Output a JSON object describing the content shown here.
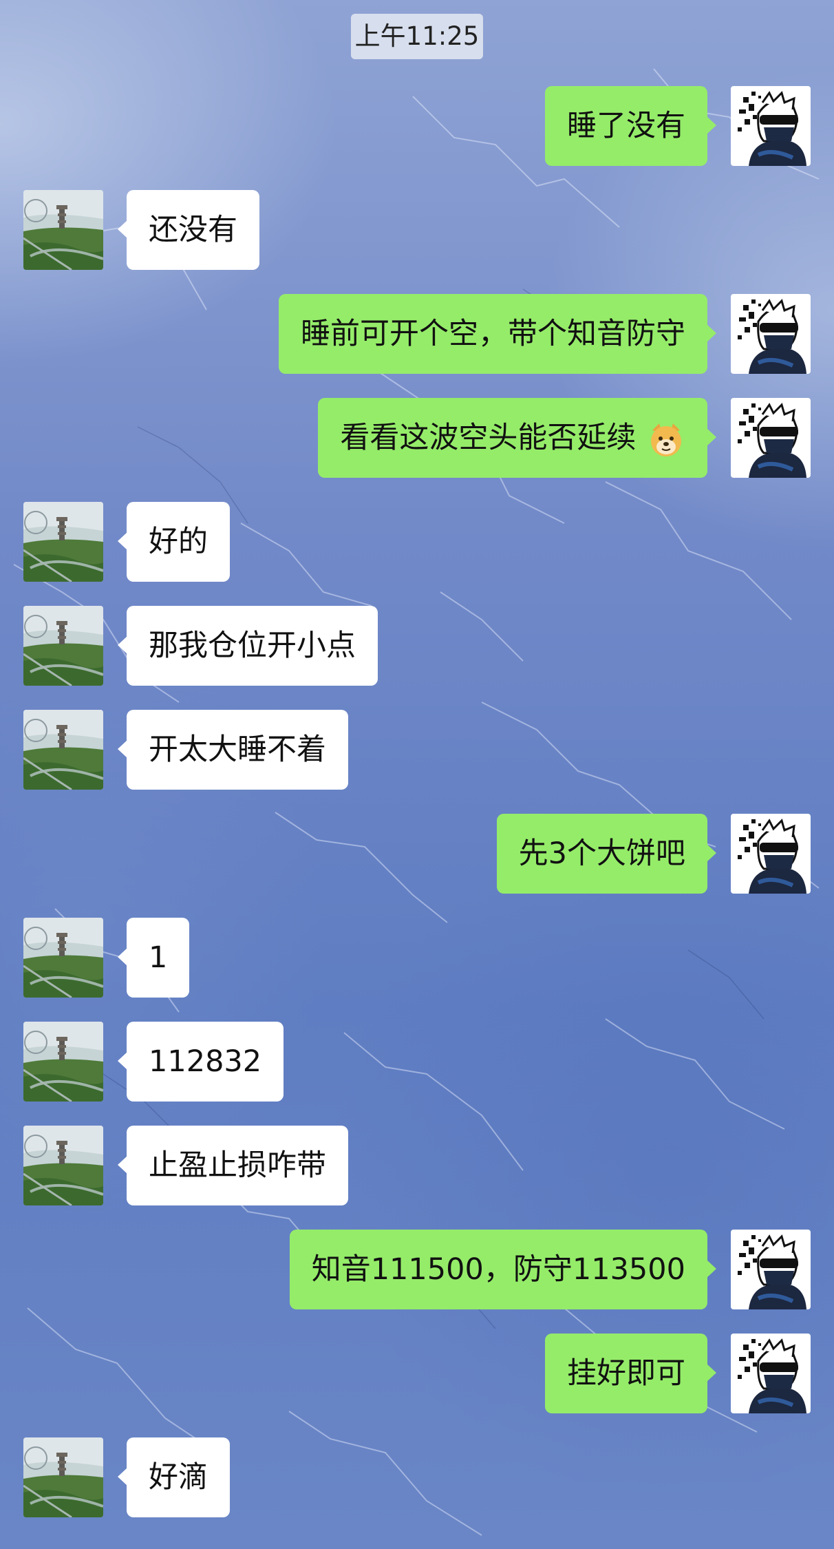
{
  "time_label": "上午11:25",
  "colors": {
    "sent_bubble": "#95ec69",
    "received_bubble": "#ffffff",
    "background": "#6f87c6"
  },
  "messages": [
    {
      "side": "right",
      "text": "睡了没有"
    },
    {
      "side": "left",
      "text": "还没有"
    },
    {
      "side": "right",
      "text": "睡前可开个空，带个知音防守"
    },
    {
      "side": "right",
      "text": "看看这波空头能否延续",
      "emoji": "doge-emoji"
    },
    {
      "side": "left",
      "text": "好的"
    },
    {
      "side": "left",
      "text": "那我仓位开小点"
    },
    {
      "side": "left",
      "text": "开太大睡不着"
    },
    {
      "side": "right",
      "text": "先3个大饼吧"
    },
    {
      "side": "left",
      "text": "1"
    },
    {
      "side": "left",
      "text": "112832"
    },
    {
      "side": "left",
      "text": "止盈止损咋带"
    },
    {
      "side": "right",
      "text": "知音111500，防守113500"
    },
    {
      "side": "right",
      "text": "挂好即可"
    },
    {
      "side": "left",
      "text": "好滴"
    }
  ],
  "avatars": {
    "left": "landscape-tower-avatar",
    "right": "masked-sunglasses-avatar"
  }
}
